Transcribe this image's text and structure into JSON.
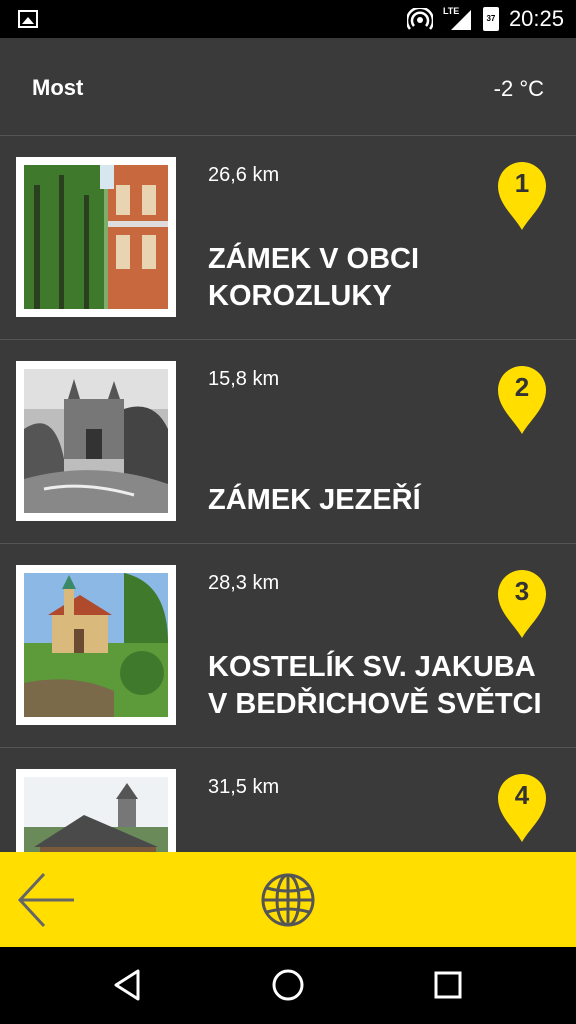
{
  "status_bar": {
    "time": "20:25",
    "network": "LTE",
    "battery": "37",
    "icons": [
      "image-icon",
      "hotspot-icon",
      "signal-icon",
      "battery-icon"
    ]
  },
  "header": {
    "city": "Most",
    "temperature": "-2 °C"
  },
  "places": [
    {
      "number": "1",
      "distance": "26,6 km",
      "title": "ZÁMEK V OBCI KOROZLUKY"
    },
    {
      "number": "2",
      "distance": "15,8 km",
      "title": "ZÁMEK JEZEŘÍ"
    },
    {
      "number": "3",
      "distance": "28,3 km",
      "title": "KOSTELÍK SV. JAKUBA V BEDŘICHOVĚ SVĚTCI"
    },
    {
      "number": "4",
      "distance": "31,5 km",
      "title": ""
    }
  ],
  "colors": {
    "accent": "#ffde00",
    "background": "#3a3a3a",
    "divider": "#555555"
  }
}
